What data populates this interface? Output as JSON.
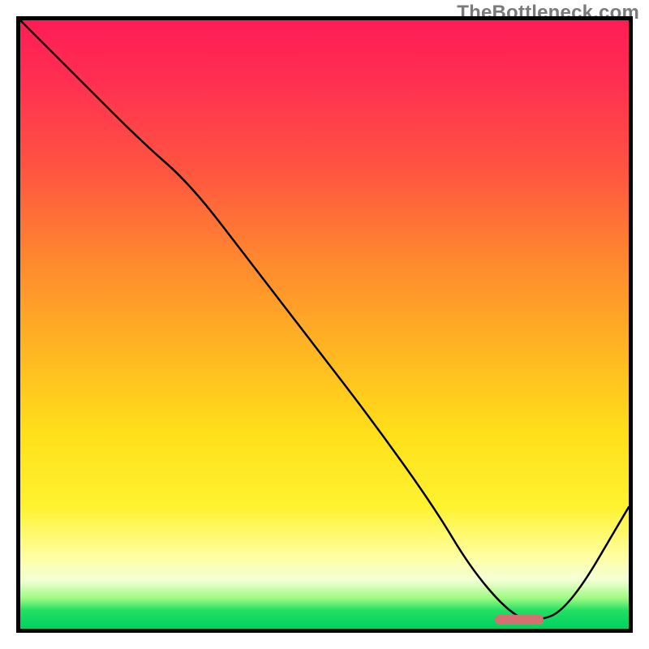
{
  "watermark": "TheBottleneck.com",
  "chart_data": {
    "type": "line",
    "title": "",
    "xlabel": "",
    "ylabel": "",
    "x_range": [
      0,
      100
    ],
    "y_range": [
      0,
      100
    ],
    "series": [
      {
        "name": "bottleneck-curve",
        "x": [
          0,
          10,
          20,
          28,
          38,
          48,
          58,
          68,
          74,
          80,
          84,
          90,
          100
        ],
        "y": [
          100,
          90,
          80,
          73,
          60,
          47,
          34,
          20,
          10,
          3,
          1,
          3,
          20
        ]
      }
    ],
    "marker": {
      "name": "optimal-range",
      "x_start": 78,
      "x_end": 86,
      "y": 1.5,
      "shape": "pill"
    },
    "background_gradient": {
      "stops": [
        {
          "pos": 0,
          "color": "#ff1c55"
        },
        {
          "pos": 25,
          "color": "#ff5640"
        },
        {
          "pos": 55,
          "color": "#ffb822"
        },
        {
          "pos": 80,
          "color": "#fff230"
        },
        {
          "pos": 92,
          "color": "#f5ffd6"
        },
        {
          "pos": 100,
          "color": "#00d060"
        }
      ]
    }
  }
}
